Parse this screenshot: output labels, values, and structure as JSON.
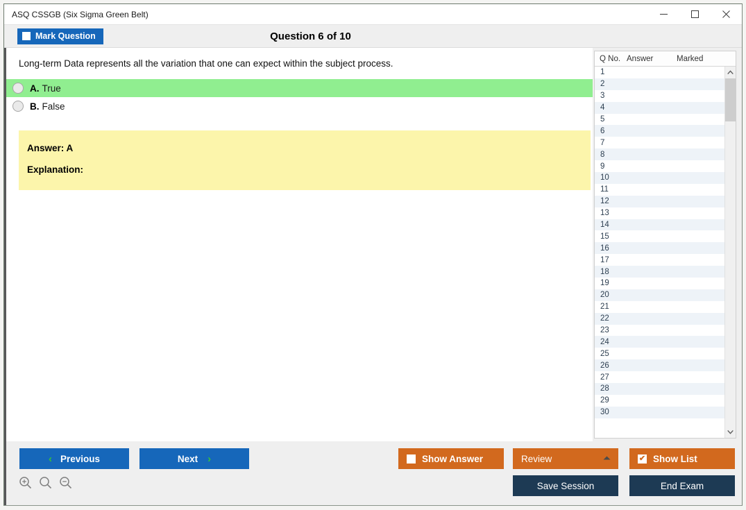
{
  "window": {
    "title": "ASQ CSSGB (Six Sigma Green Belt)",
    "controls": {
      "minimize": "minimize-icon",
      "maximize": "maximize-icon",
      "close": "close-icon"
    }
  },
  "header": {
    "mark_question_label": "Mark Question",
    "mark_question_checked": false,
    "question_counter": "Question 6 of 10"
  },
  "question": {
    "text": "Long-term Data represents all the variation that one can expect within the subject process.",
    "options": [
      {
        "letter": "A.",
        "label": "True",
        "highlighted": true
      },
      {
        "letter": "B.",
        "label": "False",
        "highlighted": false
      }
    ]
  },
  "answer_panel": {
    "answer_line": "Answer: A",
    "explanation_line": "Explanation:"
  },
  "question_list": {
    "columns": [
      "Q No.",
      "Answer",
      "Marked"
    ],
    "rows": [
      {
        "no": "1",
        "answer": "",
        "marked": ""
      },
      {
        "no": "2",
        "answer": "",
        "marked": ""
      },
      {
        "no": "3",
        "answer": "",
        "marked": ""
      },
      {
        "no": "4",
        "answer": "",
        "marked": ""
      },
      {
        "no": "5",
        "answer": "",
        "marked": ""
      },
      {
        "no": "6",
        "answer": "",
        "marked": ""
      },
      {
        "no": "7",
        "answer": "",
        "marked": ""
      },
      {
        "no": "8",
        "answer": "",
        "marked": ""
      },
      {
        "no": "9",
        "answer": "",
        "marked": ""
      },
      {
        "no": "10",
        "answer": "",
        "marked": ""
      },
      {
        "no": "11",
        "answer": "",
        "marked": ""
      },
      {
        "no": "12",
        "answer": "",
        "marked": ""
      },
      {
        "no": "13",
        "answer": "",
        "marked": ""
      },
      {
        "no": "14",
        "answer": "",
        "marked": ""
      },
      {
        "no": "15",
        "answer": "",
        "marked": ""
      },
      {
        "no": "16",
        "answer": "",
        "marked": ""
      },
      {
        "no": "17",
        "answer": "",
        "marked": ""
      },
      {
        "no": "18",
        "answer": "",
        "marked": ""
      },
      {
        "no": "19",
        "answer": "",
        "marked": ""
      },
      {
        "no": "20",
        "answer": "",
        "marked": ""
      },
      {
        "no": "21",
        "answer": "",
        "marked": ""
      },
      {
        "no": "22",
        "answer": "",
        "marked": ""
      },
      {
        "no": "23",
        "answer": "",
        "marked": ""
      },
      {
        "no": "24",
        "answer": "",
        "marked": ""
      },
      {
        "no": "25",
        "answer": "",
        "marked": ""
      },
      {
        "no": "26",
        "answer": "",
        "marked": ""
      },
      {
        "no": "27",
        "answer": "",
        "marked": ""
      },
      {
        "no": "28",
        "answer": "",
        "marked": ""
      },
      {
        "no": "29",
        "answer": "",
        "marked": ""
      },
      {
        "no": "30",
        "answer": "",
        "marked": ""
      }
    ]
  },
  "footer": {
    "previous_label": "Previous",
    "next_label": "Next",
    "show_answer_label": "Show Answer",
    "show_answer_checked": false,
    "review_value": "Review",
    "show_list_label": "Show List",
    "show_list_checked": true,
    "show_list_check_glyph": "✔",
    "save_session_label": "Save Session",
    "end_exam_label": "End Exam",
    "prev_chevron": "‹",
    "next_chevron": "›",
    "zoom_tools": [
      "zoom-in-icon",
      "zoom-reset-icon",
      "zoom-out-icon"
    ]
  },
  "colors": {
    "primary_blue": "#1667ba",
    "accent_orange": "#d2691e",
    "navy": "#1d3a54",
    "correct_green": "#90ee90",
    "answer_yellow": "#fcf5ab",
    "chevron_green": "#36c03a"
  }
}
